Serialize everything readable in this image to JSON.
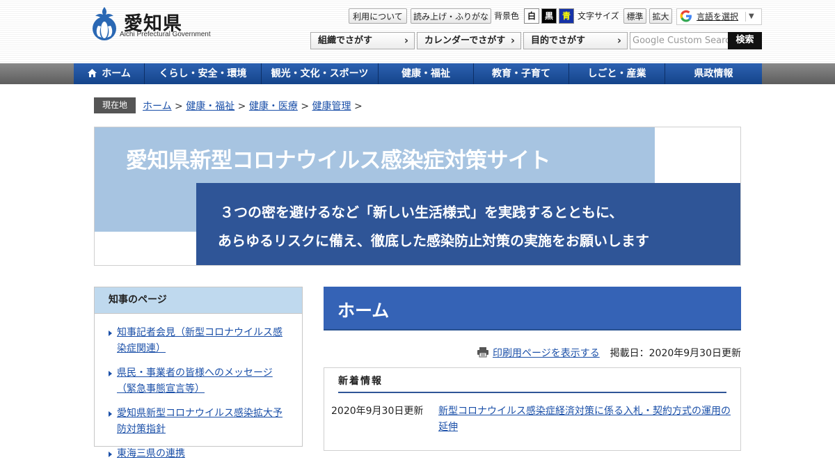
{
  "header": {
    "logo_jp": "愛知県",
    "logo_en": "Aichi Prefectural Government",
    "utility_buttons": [
      "利用について",
      "読み上げ・ふりがな"
    ],
    "bg_color_label": "背景色",
    "bg_colors": [
      {
        "label": "白",
        "bg": "#ffffff",
        "fg": "#111111"
      },
      {
        "label": "黒",
        "bg": "#000000",
        "fg": "#ffffff"
      },
      {
        "label": "青",
        "bg": "#1532a8",
        "fg": "#ffff00"
      }
    ],
    "font_size_label": "文字サイズ",
    "font_size_buttons": [
      "標準",
      "拡大"
    ],
    "translate_label": "言語を選択",
    "translate_arrow": "▼",
    "search_buttons": [
      "組織でさがす",
      "カレンダーでさがす",
      "目的でさがす"
    ],
    "search_placeholder": "Google Custom Search",
    "search_submit": "検索"
  },
  "nav": {
    "items": [
      {
        "label": "ホーム",
        "width": 102
      },
      {
        "label": "くらし・安全・環境",
        "width": 168
      },
      {
        "label": "観光・文化・スポーツ",
        "width": 168
      },
      {
        "label": "健康・福祉",
        "width": 137
      },
      {
        "label": "教育・子育て",
        "width": 137
      },
      {
        "label": "しごと・産業",
        "width": 138
      },
      {
        "label": "県政情報",
        "width": 139
      }
    ]
  },
  "breadcrumb": {
    "here_label": "現在地",
    "items": [
      "ホーム",
      "健康・福祉",
      "健康・医療",
      "健康管理"
    ],
    "separator": " > "
  },
  "banner": {
    "title": "愛知県新型コロナウイルス感染症対策サイト",
    "message_line1": "３つの密を避けるなど「新しい生活様式」を実践するとともに、",
    "message_line2": "あらゆるリスクに備え、徹底した感染防止対策の実施をお願いします",
    "light_color": "#a7c4e1",
    "dark_color": "#2f5597"
  },
  "sidebar": {
    "title": "知事のページ",
    "items": [
      "知事記者会見（新型コロナウイルス感染症関連）",
      "県民・事業者の皆様へのメッセージ（緊急事態宣言等）",
      "愛知県新型コロナウイルス感染拡大予防対策指針",
      "東海三県の連携"
    ]
  },
  "main": {
    "page_title": "ホーム",
    "print_link": "印刷用ページを表示する",
    "posted_date": "掲載日：2020年9月30日更新",
    "news": {
      "heading": "新着情報",
      "items": [
        {
          "date": "2020年9月30日更新",
          "title": "新型コロナウイルス感染症経済対策に係る入札・契約方式の運用の延伸"
        }
      ]
    }
  },
  "colors": {
    "nav_blue": "#1f55a0",
    "title_blue": "#3563b6",
    "link": "#1a4fa8"
  }
}
